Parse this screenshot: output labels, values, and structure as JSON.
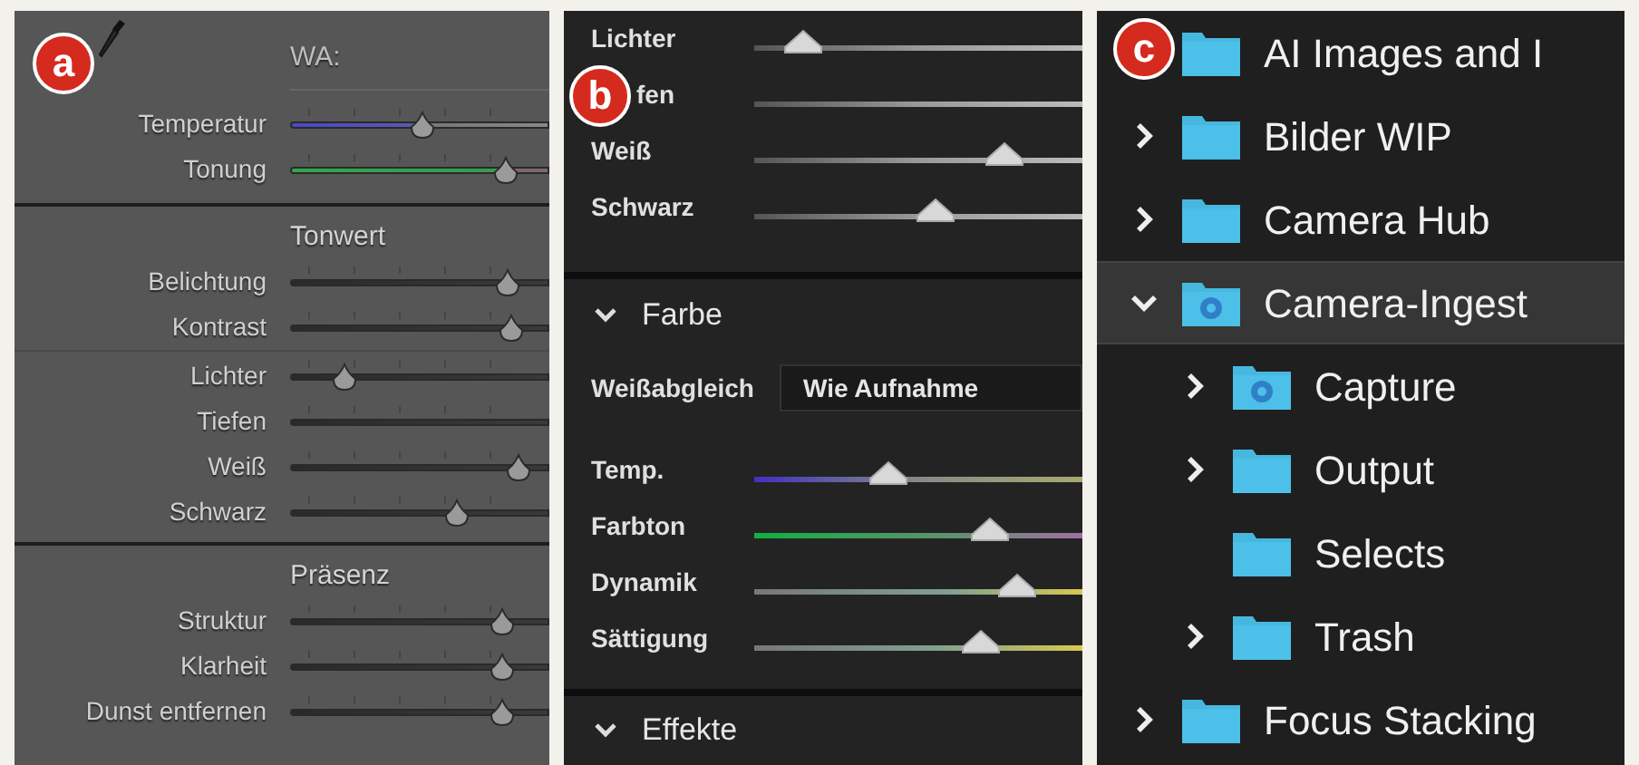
{
  "panels": [
    {
      "kind": "classic",
      "badge": "a",
      "sections": [
        {
          "title": "WA:",
          "eyedropper": true,
          "groups": [
            [
              {
                "label": "Temperatur",
                "kind": "temperature",
                "level": 0.51
              },
              {
                "label": "Tonung",
                "kind": "tint",
                "level": 0.83
              }
            ]
          ]
        },
        {
          "title": "Tonwert",
          "eyedropper": false,
          "groups": [
            [
              {
                "label": "Belichtung",
                "kind": "plain",
                "level": 0.84
              },
              {
                "label": "Kontrast",
                "kind": "plain",
                "level": 0.85
              }
            ],
            [
              {
                "label": "Lichter",
                "kind": "plain",
                "level": 0.21
              },
              {
                "label": "Tiefen",
                "kind": "plain"
              },
              {
                "label": "Weiß",
                "kind": "plain",
                "level": 0.88
              },
              {
                "label": "Schwarz",
                "kind": "plain",
                "level": 0.64
              }
            ]
          ]
        },
        {
          "title": "Präsenz",
          "eyedropper": false,
          "groups": [
            [
              {
                "label": "Struktur",
                "kind": "plain",
                "level": 0.82
              },
              {
                "label": "Klarheit",
                "kind": "plain",
                "level": 0.82
              },
              {
                "label": "Dunst entfernen",
                "kind": "plain",
                "level": 0.82
              }
            ]
          ]
        }
      ]
    },
    {
      "kind": "modern",
      "badge": "b",
      "top_sliders": [
        {
          "label": "Lichter",
          "kind": "plain",
          "covered": false,
          "level": 0.15
        },
        {
          "label": "fen",
          "kind": "plain",
          "covered": true
        },
        {
          "label": "Weiß",
          "kind": "plain",
          "covered": false,
          "level": 0.76
        },
        {
          "label": "Schwarz",
          "kind": "plain",
          "covered": false,
          "level": 0.55
        }
      ],
      "color_section": {
        "title": "Farbe",
        "expanded": true,
        "white_balance": {
          "label": "Weißabgleich",
          "value": "Wie Aufnahme"
        },
        "sliders": [
          {
            "label": "Temp.",
            "kind": "temperature",
            "covered": false,
            "level": 0.41
          },
          {
            "label": "Farbton",
            "kind": "tint",
            "covered": false,
            "level": 0.72
          },
          {
            "label": "Dynamik",
            "kind": "vibrance",
            "covered": false,
            "level": 0.8
          },
          {
            "label": "Sättigung",
            "kind": "saturation",
            "covered": false,
            "level": 0.69
          }
        ]
      },
      "effects_section": {
        "title": "Effekte",
        "expanded": true
      }
    },
    {
      "kind": "tree",
      "badge": "c",
      "folders": [
        {
          "name": "AI Images and I",
          "kind": "plain",
          "selected": false
        },
        {
          "name": "Bilder WIP",
          "kind": "plain",
          "expanded": false,
          "selected": false
        },
        {
          "name": "Camera Hub",
          "kind": "plain",
          "expanded": false,
          "selected": false
        },
        {
          "name": "Camera-Ingest",
          "kind": "emblem",
          "expanded": true,
          "selected": true,
          "children": [
            {
              "name": "Capture",
              "kind": "emblem",
              "expanded": false,
              "selected": false
            },
            {
              "name": "Output",
              "kind": "plain",
              "expanded": false,
              "selected": false
            },
            {
              "name": "Selects",
              "kind": "plain",
              "selected": false
            },
            {
              "name": "Trash",
              "kind": "plain",
              "expanded": false,
              "selected": false
            }
          ]
        },
        {
          "name": "Focus Stacking",
          "kind": "plain",
          "expanded": false,
          "selected": false
        }
      ]
    }
  ]
}
